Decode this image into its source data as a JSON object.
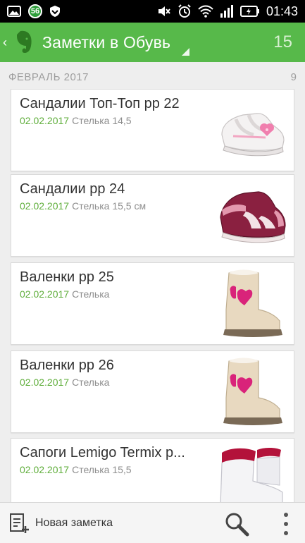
{
  "status_bar": {
    "time": "01:43",
    "badge": "56",
    "icons": [
      "gallery-icon",
      "notification-badge",
      "shield-icon",
      "mute-icon",
      "alarm-icon",
      "wifi-icon",
      "signal-icon",
      "battery-icon"
    ]
  },
  "header": {
    "title": "Заметки в Обувь",
    "count": "15",
    "color": "#57b94a"
  },
  "section": {
    "title": "ФЕВРАЛЬ 2017",
    "count": "9"
  },
  "notes": [
    {
      "title": "Сандалии Топ-Топ рр 22",
      "date": "02.02.2017",
      "snippet": "Стелька 14,5",
      "image": "white-pink-sandal"
    },
    {
      "title": "Сандалии рр 24",
      "date": "02.02.2017",
      "snippet": "Стелька 15,5 см",
      "image": "burgundy-sandal"
    },
    {
      "title": "Валенки рр 25",
      "date": "02.02.2017",
      "snippet": "Стелька",
      "image": "felt-boot"
    },
    {
      "title": "Валенки рр 26",
      "date": "02.02.2017",
      "snippet": "Стелька",
      "image": "felt-boot"
    },
    {
      "title": "Сапоги Lemigo Termix р...",
      "date": "02.02.2017",
      "snippet": "Стелька 15,5",
      "image": "white-red-boot"
    }
  ],
  "bottom_bar": {
    "new_note_label": "Новая заметка"
  }
}
